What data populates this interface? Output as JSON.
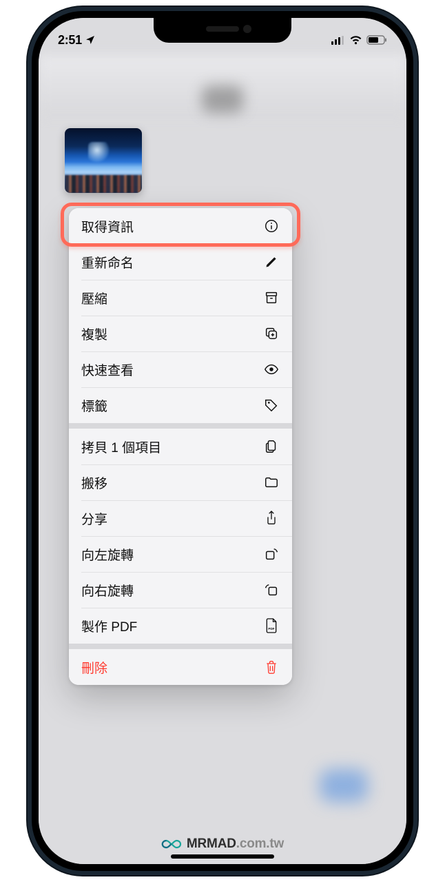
{
  "status": {
    "time": "2:51",
    "location_icon": "location-arrow",
    "signal_bars": 3,
    "wifi": true,
    "battery_level": 60
  },
  "thumbnail": {
    "description": "concert-stadium-photo"
  },
  "highlight_index": 0,
  "menu": {
    "groups": [
      {
        "items": [
          {
            "id": "get-info",
            "label": "取得資訊",
            "icon": "info-circle"
          },
          {
            "id": "rename",
            "label": "重新命名",
            "icon": "pencil"
          },
          {
            "id": "compress",
            "label": "壓縮",
            "icon": "archive-box"
          },
          {
            "id": "duplicate",
            "label": "複製",
            "icon": "duplicate-plus"
          },
          {
            "id": "quick-look",
            "label": "快速查看",
            "icon": "eye"
          },
          {
            "id": "tags",
            "label": "標籤",
            "icon": "tag"
          }
        ]
      },
      {
        "items": [
          {
            "id": "copy",
            "label": "拷貝 1 個項目",
            "icon": "two-docs"
          },
          {
            "id": "move",
            "label": "搬移",
            "icon": "folder"
          },
          {
            "id": "share",
            "label": "分享",
            "icon": "share-up"
          },
          {
            "id": "rotate-left",
            "label": "向左旋轉",
            "icon": "rotate-left"
          },
          {
            "id": "rotate-right",
            "label": "向右旋轉",
            "icon": "rotate-right"
          },
          {
            "id": "make-pdf",
            "label": "製作 PDF",
            "icon": "pdf-doc"
          }
        ]
      },
      {
        "items": [
          {
            "id": "delete",
            "label": "刪除",
            "icon": "trash",
            "destructive": true
          }
        ]
      }
    ]
  },
  "watermark": {
    "brand": "MRMAD",
    "domain": ".com.tw"
  }
}
